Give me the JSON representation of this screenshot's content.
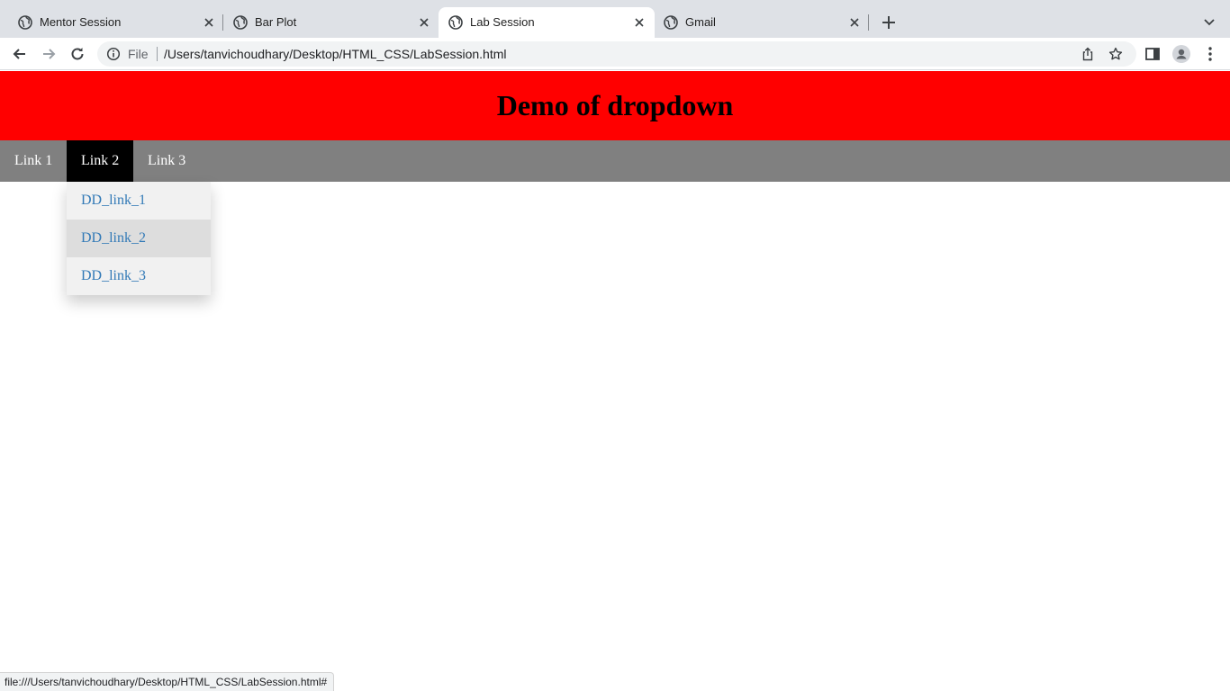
{
  "browser": {
    "tabs": [
      {
        "title": "Mentor Session",
        "icon": "globe-icon",
        "active": false
      },
      {
        "title": "Bar Plot",
        "icon": "globe-icon",
        "active": false
      },
      {
        "title": "Lab Session",
        "icon": "globe-icon",
        "active": true
      },
      {
        "title": "Gmail",
        "icon": "globe-icon",
        "active": false
      }
    ],
    "omnibox": {
      "scheme_label": "File",
      "url": "/Users/tanvichoudhary/Desktop/HTML_CSS/LabSession.html"
    },
    "status_url": "file:///Users/tanvichoudhary/Desktop/HTML_CSS/LabSession.html#"
  },
  "page": {
    "header": {
      "title": "Demo of dropdown",
      "background": "#ff0000"
    },
    "nav": {
      "background": "#808080",
      "links": [
        "Link 1",
        "Link 2",
        "Link 3"
      ],
      "active_link": "Link 2"
    },
    "dropdown": {
      "items": [
        "DD_link_1",
        "DD_link_2",
        "DD_link_3"
      ],
      "hovered_item": "DD_link_2",
      "link_color": "#337ab7"
    }
  }
}
